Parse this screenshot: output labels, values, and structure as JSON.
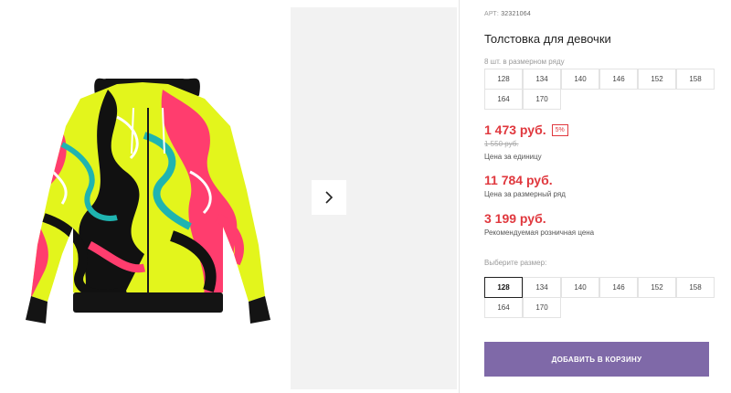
{
  "gallery": {
    "next_icon": "chevron-right-icon",
    "colors": {
      "pink": "#ff3d6e",
      "lime": "#e3f51c",
      "teal": "#1fb4b0",
      "black": "#111111"
    }
  },
  "product": {
    "sku_label": "АРТ:",
    "sku_value": "32321064",
    "title": "Толстовка для девочки",
    "pack_note": "8 шт. в размерном ряду",
    "pack_sizes": [
      "128",
      "134",
      "140",
      "146",
      "152",
      "158",
      "164",
      "170"
    ]
  },
  "prices": {
    "unit_price": "1 473 руб.",
    "discount": "5%",
    "old_price": "1 550 руб.",
    "unit_label": "Цена за единицу",
    "pack_price": "11 784 руб.",
    "pack_label": "Цена за размерный ряд",
    "retail_price": "3 199 руб.",
    "retail_label": "Рекомендуемая розничная цена"
  },
  "size_select": {
    "label": "Выберите размер:",
    "sizes": [
      "128",
      "134",
      "140",
      "146",
      "152",
      "158",
      "164",
      "170"
    ],
    "selected": "128"
  },
  "cart": {
    "button_label": "ДОБАВИТЬ В КОРЗИНУ",
    "accent": "#7f69a8"
  },
  "theme": {
    "price_red": "#e0383e"
  }
}
